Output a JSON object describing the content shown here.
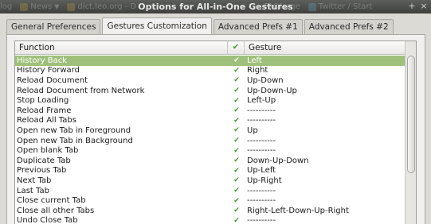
{
  "window": {
    "title": "Options for All-in-One Gestures",
    "minimize_glyph": "+",
    "close_glyph": "×"
  },
  "background_tabs": [
    {
      "label": "log"
    },
    {
      "label": "News"
    },
    {
      "label": "dict.leo.org - D"
    },
    {
      "label": "FAOforge"
    },
    {
      "label": "Twitter / Start"
    }
  ],
  "tabs": [
    {
      "label": "General Preferences"
    },
    {
      "label": "Gestures Customization"
    },
    {
      "label": "Advanced Prefs #1"
    },
    {
      "label": "Advanced Prefs #2"
    }
  ],
  "active_tab_index": 1,
  "list": {
    "columns": {
      "function": "Function",
      "enabled_icon": "checkmark-icon",
      "gesture": "Gesture"
    },
    "check_glyph": "✔",
    "selected_row_index": 0,
    "rows": [
      {
        "function": "History Back",
        "enabled": true,
        "gesture": "Left"
      },
      {
        "function": "History Forward",
        "enabled": true,
        "gesture": "Right"
      },
      {
        "function": "Reload Document",
        "enabled": true,
        "gesture": "Up-Down"
      },
      {
        "function": "Reload Document from Network",
        "enabled": true,
        "gesture": "Up-Down-Up"
      },
      {
        "function": "Stop Loading",
        "enabled": true,
        "gesture": "Left-Up"
      },
      {
        "function": "Reload Frame",
        "enabled": true,
        "gesture": "----------"
      },
      {
        "function": "Reload All Tabs",
        "enabled": true,
        "gesture": "----------"
      },
      {
        "function": "Open new Tab in Foreground",
        "enabled": true,
        "gesture": "Up"
      },
      {
        "function": "Open new Tab in Background",
        "enabled": true,
        "gesture": "----------"
      },
      {
        "function": "Open blank Tab",
        "enabled": true,
        "gesture": "----------"
      },
      {
        "function": "Duplicate Tab",
        "enabled": true,
        "gesture": "Down-Up-Down"
      },
      {
        "function": "Previous Tab",
        "enabled": true,
        "gesture": "Up-Left"
      },
      {
        "function": "Next Tab",
        "enabled": true,
        "gesture": "Up-Right"
      },
      {
        "function": "Last Tab",
        "enabled": true,
        "gesture": "----------"
      },
      {
        "function": "Close current Tab",
        "enabled": true,
        "gesture": "----------"
      },
      {
        "function": "Close all other Tabs",
        "enabled": true,
        "gesture": "Right-Left-Down-Up-Right"
      },
      {
        "function": "Undo Close Tab",
        "enabled": true,
        "gesture": "----------"
      }
    ]
  },
  "colors": {
    "selection": "#9fc07b",
    "check": "#3d9a28"
  }
}
